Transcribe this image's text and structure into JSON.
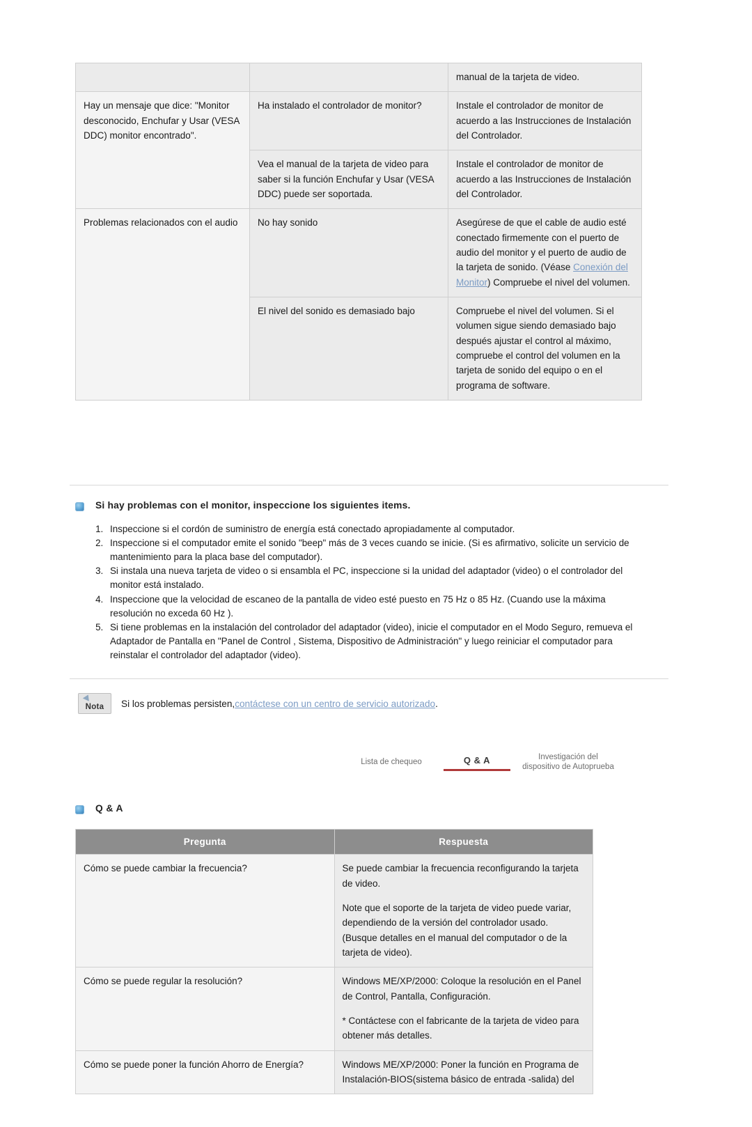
{
  "troubleshooting_table": {
    "rows": [
      {
        "symptom": "",
        "check": "",
        "solution_pre": "manual de la tarjeta de video.",
        "solution_link": "",
        "solution_post": ""
      },
      {
        "symptom": "Hay un mensaje que dice: \"Monitor desconocido, Enchufar y Usar (VESA DDC) monitor encontrado\".",
        "check": "Ha instalado el controlador de monitor?",
        "solution_pre": "Instale el controlador de monitor de acuerdo a las Instrucciones de Instalación del Controlador.",
        "solution_link": "",
        "solution_post": ""
      },
      {
        "symptom": "",
        "check": "Vea el manual de la tarjeta de video para saber si la función Enchufar y Usar (VESA DDC) puede ser soportada.",
        "solution_pre": "Instale el controlador de monitor de acuerdo a las Instrucciones de Instalación del Controlador.",
        "solution_link": "",
        "solution_post": ""
      },
      {
        "symptom": "Problemas relacionados con el audio",
        "check": "No hay sonido",
        "solution_pre": "Asegúrese de que el cable de audio esté conectado firmemente con el puerto de audio del monitor y el puerto de audio de la tarjeta de sonido. (Véase ",
        "solution_link": "Conexión del Monitor",
        "solution_post": ") Compruebe el nivel del volumen."
      },
      {
        "symptom": "",
        "check": "El nivel del sonido es demasiado bajo",
        "solution_pre": "Compruebe el nivel del volumen. Si el volumen sigue siendo demasiado bajo después ajustar el control al máximo, compruebe el control del volumen en la tarjeta de sonido del equipo o en el programa de software.",
        "solution_link": "",
        "solution_post": ""
      }
    ]
  },
  "inspection": {
    "heading": "Si hay problemas con el monitor, inspeccione los siguientes items.",
    "bullet_icon": "blue-diamond-icon",
    "items": [
      "Inspeccione si el cordón de suministro de energía está conectado apropiadamente al computador.",
      "Inspeccione si el computador emite el sonido \"beep\" más de 3 veces cuando se inicie. (Si es afirmativo, solicite un servicio de mantenimiento para la placa base del computador).",
      "Si instala una nueva tarjeta de video o si ensambla el PC, inspeccione si la unidad del adaptador (video) o el controlador del monitor está instalado.",
      "Inspeccione que la velocidad de escaneo de la pantalla de video esté puesto en 75 Hz o 85 Hz. (Cuando use la máxima resolución no exceda 60 Hz ).",
      "Si tiene problemas en la instalación del controlador del adaptador (video), inicie el computador en el Modo Seguro, remueva el Adaptador de Pantalla en \"Panel de Control , Sistema, Dispositivo de Administración\" y luego reiniciar el computador para reinstalar el controlador del adaptador (video)."
    ]
  },
  "note": {
    "badge_label": "Nota",
    "badge_icon": "note-pin-icon",
    "text_pre": "Si los problemas persisten, ",
    "link": "contáctese con un centro de servicio autorizado",
    "text_post": "."
  },
  "navstrip": {
    "left": "Lista de chequeo",
    "middle": "Q & A",
    "right_line1": "Investigación del",
    "right_line2": "dispositivo de Autoprueba"
  },
  "qa_section": {
    "heading": "Q & A",
    "bullet_icon": "blue-diamond-icon",
    "columns": [
      "Pregunta",
      "Respuesta"
    ],
    "rows": [
      {
        "question": "Cómo se puede cambiar la frecuencia?",
        "answer_paragraphs": [
          "Se puede cambiar la frecuencia reconfigurando la tarjeta de video.",
          "Note que el soporte de la tarjeta de video puede variar, dependiendo de la versión del controlador usado. (Busque detalles en el manual del computador o de la tarjeta de video)."
        ]
      },
      {
        "question": "Cómo se puede regular la resolución?",
        "answer_paragraphs": [
          "Windows ME/XP/2000: Coloque la resolución en el Panel de Control, Pantalla, Configuración.",
          "* Contáctese con el fabricante de la tarjeta de video para obtener más detalles."
        ]
      },
      {
        "question": "Cómo se puede poner la función Ahorro de Energía?",
        "answer_paragraphs": [
          "Windows ME/XP/2000: Poner la función en Programa de Instalación-BIOS(sistema básico de entrada -salida) del"
        ]
      }
    ]
  }
}
